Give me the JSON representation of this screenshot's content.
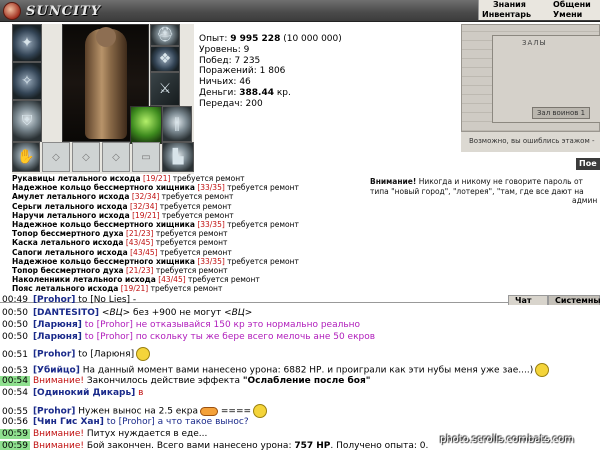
{
  "app": {
    "logo_text": "SUNCITY"
  },
  "top_nav": {
    "znaniya": "Знания",
    "obsch": "Общени",
    "inventar": "Инвентарь",
    "umen": "Умени"
  },
  "stats": [
    {
      "label": "Опыт:",
      "value": "9 995 228",
      "extra": "(10 000 000)"
    },
    {
      "label": "Уровень:",
      "value": "9"
    },
    {
      "label": "Побед:",
      "value": "7 235"
    },
    {
      "label": "Поражений:",
      "value": "1 806"
    },
    {
      "label": "Ничьих:",
      "value": "46"
    },
    {
      "label": "Деньги:",
      "value": "388.44",
      "extra": "кр."
    },
    {
      "label": "Передач:",
      "value": "200"
    }
  ],
  "location": {
    "title": "ЗАЛЫ",
    "button": "Зал воинов 1",
    "note": "Возможно, вы ошиблись этажом -",
    "go_button": "Пое"
  },
  "repairs": [
    {
      "name": "Рукавицы летального исхода",
      "count": "[19/21]",
      "status": "требуется ремонт"
    },
    {
      "name": "Надежное кольцо бессмертного хищника",
      "count": "[33/35]",
      "status": "требуется ремонт"
    },
    {
      "name": "Амулет летального исхода",
      "count": "[32/34]",
      "status": "требуется ремонт"
    },
    {
      "name": "Серьги летального исхода",
      "count": "[32/34]",
      "status": "требуется ремонт"
    },
    {
      "name": "Наручи летального исхода",
      "count": "[19/21]",
      "status": "требуется ремонт"
    },
    {
      "name": "Надежное кольцо бессмертного хищника",
      "count": "[33/35]",
      "status": "требуется ремонт"
    },
    {
      "name": "Топор бессмертного духа",
      "count": "[21/23]",
      "status": "требуется ремонт"
    },
    {
      "name": "Каска летального исхода",
      "count": "[43/45]",
      "status": "требуется ремонт"
    },
    {
      "name": "Сапоги летального исхода",
      "count": "[43/45]",
      "status": "требуется ремонт"
    },
    {
      "name": "Надежное кольцо бессмертного хищника",
      "count": "[33/35]",
      "status": "требуется ремонт"
    },
    {
      "name": "Топор бессмертного духа",
      "count": "[21/23]",
      "status": "требуется ремонт"
    },
    {
      "name": "Наколенники летального исхода",
      "count": "[43/45]",
      "status": "требуется ремонт"
    },
    {
      "name": "Пояс летального исхода",
      "count": "[19/21]",
      "status": "требуется ремонт"
    }
  ],
  "warning": {
    "label": "Внимание!",
    "line1": "Никогда и никому не говорите пароль от",
    "line2": "типа \"новый город\", \"лотерея\", \"там, где все дают на",
    "line3": "админ"
  },
  "chat_tabs": {
    "chat": "Чат",
    "system": "Системны"
  },
  "chat": {
    "m1": {
      "time": "00:49",
      "nick": "[Prohor]",
      "to": "to [No Lies]",
      "text": " -"
    },
    "m2": {
      "time": "00:50",
      "nick": "[DANTESITO]",
      "to": "<ВЦ>",
      "text": " без +900 не могут ",
      "to2": "<ВЦ>"
    },
    "m3": {
      "time": "00:50",
      "nick": "[Ларюня]",
      "text": " to [Prohor] не отказывайся 150 кр это нормально реально"
    },
    "m4": {
      "time": "00:50",
      "nick": "[Ларюня]",
      "text": " to [Prohor] по скольку ты же бере всего мелочь ане 50 екров"
    },
    "m5": {
      "time": "00:51",
      "nick": "[Prohor]",
      "to": "to [Ларюня]"
    },
    "m6": {
      "time": "00:53",
      "nick": "[Убийцо]",
      "text": " На данный момент вами нанесено урона: 6882 НР. и проиграли как эти нубы меня уже зае....)"
    },
    "m7": {
      "time": "00:54",
      "warn": "Внимание!",
      "text": " Закончилось действие эффекта ",
      "effect": "\"Ослабление после боя\""
    },
    "m8": {
      "time": "00:54",
      "nick": "[Одинокий Дикарь]",
      "text": " в"
    },
    "m9": {
      "time": "00:55",
      "nick": "[Prohor]",
      "text": " Нужен вынос на 2.5 екра",
      "tail": "===="
    },
    "m10": {
      "time": "00:56",
      "nick": "[Чин Гис Хан]",
      "text": " to [Prohor] а что такое вынос?"
    },
    "m11": {
      "time": "00:59",
      "warn": "Внимание!",
      "text": " Питух нуждается в еде..."
    },
    "m12": {
      "time": "00:59",
      "warn": "Внимание!",
      "text": " Бой закончен. Всего вами нанесено урона: ",
      "value": "757 НР",
      "tail": ". Получено опыта: 0."
    }
  },
  "watermark": "photo.scrolls.combats.com",
  "colors": {
    "accent_red": "#c01010",
    "purple": "#b01dbb",
    "nick_blue": "#1a2a8a",
    "time_highlight": "#8fe08f"
  }
}
